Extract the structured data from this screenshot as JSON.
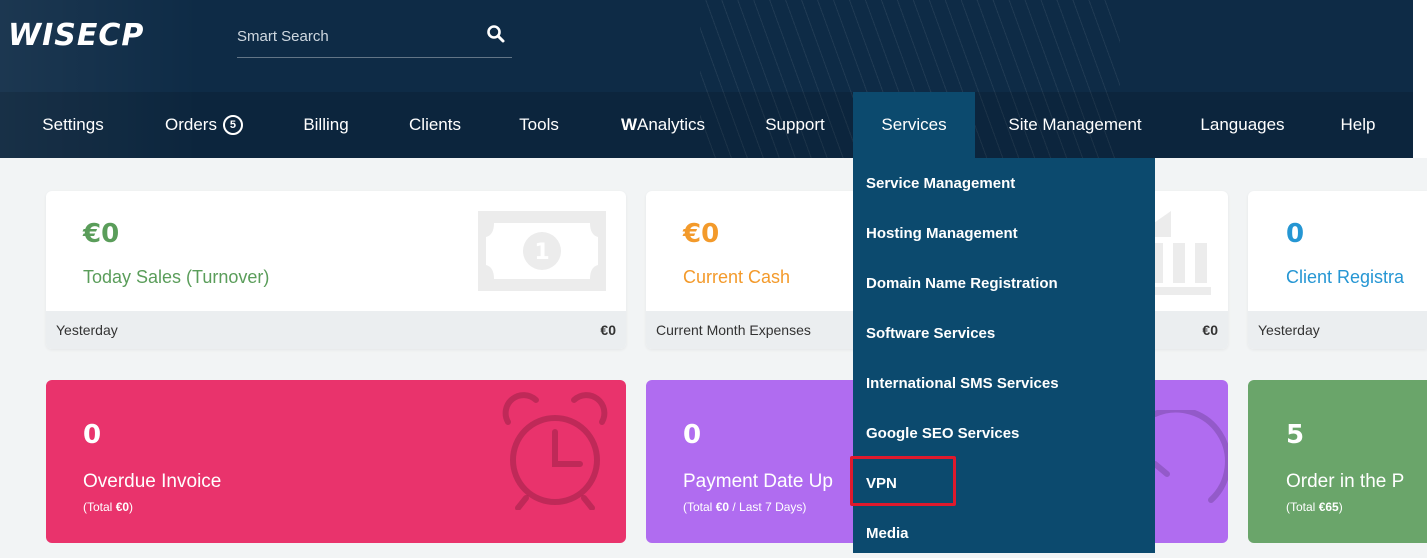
{
  "header": {
    "logo": "WISECP",
    "search": {
      "placeholder": "Smart Search"
    }
  },
  "nav": {
    "items": [
      {
        "label": "Settings"
      },
      {
        "label": "Orders",
        "badge": "5"
      },
      {
        "label": "Billing"
      },
      {
        "label": "Clients"
      },
      {
        "label": "Tools"
      },
      {
        "label_bold": "W",
        "label": "Analytics"
      },
      {
        "label": "Support"
      },
      {
        "label": "Services"
      },
      {
        "label": "Site Management"
      },
      {
        "label": "Languages"
      },
      {
        "label": "Help"
      }
    ]
  },
  "services_menu": {
    "items": [
      "Service Management",
      "Hosting Management",
      "Domain Name Registration",
      "Software Services",
      "International SMS Services",
      "Google SEO Services",
      "VPN",
      "Media"
    ]
  },
  "stats_top": [
    {
      "value": "€0",
      "label": "Today Sales (Turnover)",
      "footer_label": "Yesterday",
      "footer_value": "€0",
      "color": "#5a9d5a",
      "icon": "banknote-icon"
    },
    {
      "value": "€0",
      "label": "Current Cash",
      "footer_label": "Current Month Expenses",
      "footer_value": "€0",
      "color": "#f39a2b",
      "icon": "bank-icon"
    },
    {
      "value": "0",
      "label": "Client Registra",
      "footer_label": "Yesterday",
      "footer_value": "",
      "color": "#2596d3",
      "icon": ""
    }
  ],
  "stats_bottom": [
    {
      "value": "0",
      "label": "Overdue Invoice",
      "sub_prefix": "(Total ",
      "sub_bold": "€0",
      "sub_suffix": ")",
      "bg": "#e9336c",
      "icon": "alarm-clock-icon"
    },
    {
      "value": "0",
      "label": "Payment Date Up",
      "sub_prefix": "(Total ",
      "sub_bold": "€0",
      "sub_suffix": " / Last 7 Days)",
      "bg": "#b06cf0",
      "icon": "stopwatch-icon"
    },
    {
      "value": "5",
      "label": "Order in the P",
      "sub_prefix": "(Total ",
      "sub_bold": "€65",
      "sub_suffix": ")",
      "bg": "#6aa56a",
      "icon": ""
    }
  ]
}
